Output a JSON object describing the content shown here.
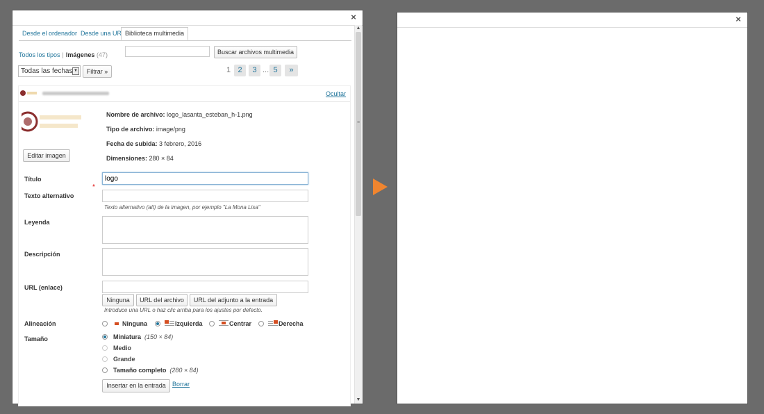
{
  "left": {
    "close_glyph": "×",
    "tabs": [
      {
        "label": "Desde el ordenador",
        "active": false
      },
      {
        "label": "Desde una URL",
        "active": false
      },
      {
        "label": "Biblioteca multimedia",
        "active": true
      }
    ],
    "filter": {
      "all_types": "Todos los tipos",
      "separator": "|",
      "images": "Imágenes",
      "images_count": "(47)",
      "search_button": "Buscar archivos multimedia",
      "dates_select": "Todas las fechas",
      "filter_button": "Filtrar »"
    },
    "pagination": {
      "current": "1",
      "pages": [
        "2",
        "3"
      ],
      "ellipsis": "...",
      "last": "5",
      "next": "»"
    },
    "item": {
      "hide_link": "Ocultar",
      "edit_image_button": "Editar imagen",
      "meta": {
        "filename_label": "Nombre de archivo:",
        "filename": "logo_lasanta_esteban_h-1.png",
        "filetype_label": "Tipo de archivo:",
        "filetype": "image/png",
        "upload_label": "Fecha de subida:",
        "upload": "3 febrero, 2016",
        "dims_label": "Dimensiones:",
        "dims": "280 × 84"
      },
      "fields": {
        "title_label": "Título",
        "required_mark": "*",
        "title_value": "logo",
        "alt_label": "Texto alternativo",
        "alt_help": "Texto alternativo (alt) de la imagen, por ejemplo \"La Mona Lisa\"",
        "caption_label": "Leyenda",
        "description_label": "Descripción",
        "url_label": "URL (enlace)",
        "url_buttons": [
          "Ninguna",
          "URL del archivo",
          "URL del adjunto a la entrada"
        ],
        "url_help": "Introduce una URL o haz clic arriba para los ajustes por defecto.",
        "align_label": "Alineación",
        "align_options": [
          "Ninguna",
          "Izquierda",
          "Centrar",
          "Derecha"
        ],
        "align_selected": "Izquierda",
        "size_label": "Tamaño",
        "size_options": [
          {
            "label": "Miniatura",
            "dims": "(150 × 84)",
            "enabled": true,
            "selected": true
          },
          {
            "label": "Medio",
            "dims": "",
            "enabled": false,
            "selected": false
          },
          {
            "label": "Grande",
            "dims": "",
            "enabled": false,
            "selected": false
          },
          {
            "label": "Tamaño completo",
            "dims": "(280 × 84)",
            "enabled": true,
            "selected": false
          }
        ],
        "insert_button": "Insertar en la entrada",
        "delete_link": "Borrar"
      }
    }
  },
  "right": {
    "close_glyph": "×"
  },
  "colors": {
    "accent": "#21759b",
    "arrow": "#f0852f",
    "backdrop": "#6b6b6b"
  }
}
